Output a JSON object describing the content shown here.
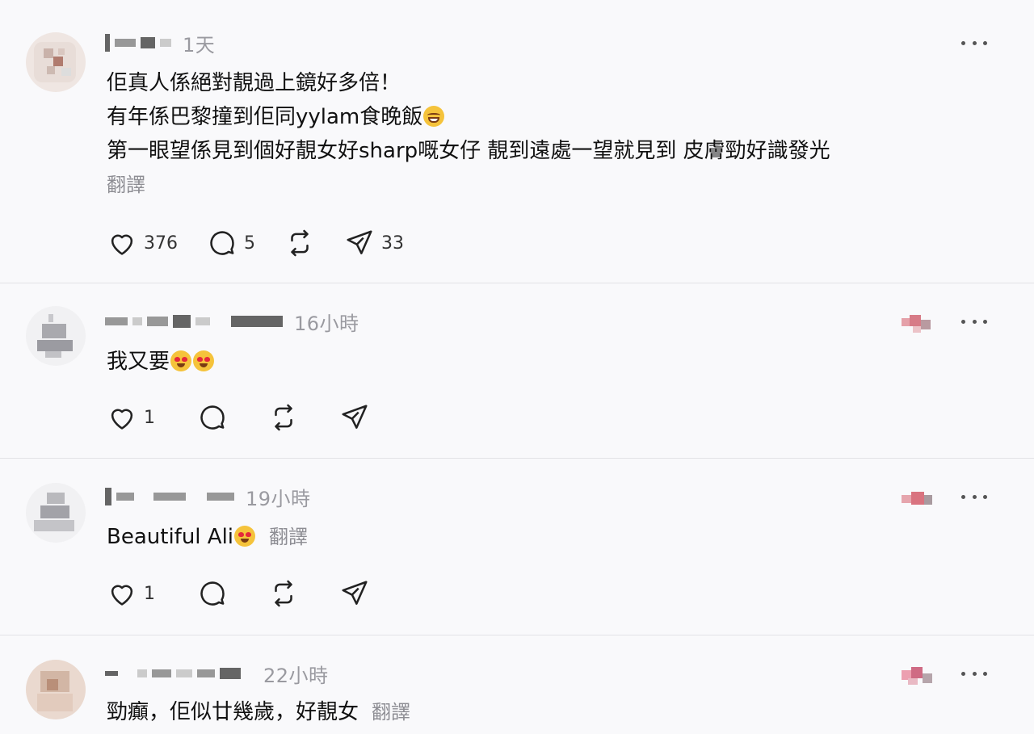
{
  "posts": [
    {
      "time": "1天",
      "lines": [
        "佢真人係絕對靚過上鏡好多倍！",
        "有年係巴黎撞到佢同yylam食晚飯",
        "第一眼望係見到個好靚女好sharp嘅女仔 靚到遠處一望就見到 皮膚勁好識發光"
      ],
      "translate_label": "翻譯",
      "counts": {
        "likes": "376",
        "comments": "5",
        "reposts": "",
        "shares": "33"
      }
    },
    {
      "time": "16小時",
      "text": "我又要",
      "counts": {
        "likes": "1"
      }
    },
    {
      "time": "19小時",
      "text": "Beautiful Ali",
      "translate_label": "翻譯",
      "counts": {
        "likes": "1"
      }
    },
    {
      "time": "22小時",
      "text": "勁癲，佢似廿幾歲，好靚女",
      "translate_label": "翻譯"
    }
  ],
  "icons": {
    "like": "heart-icon",
    "comment": "comment-bubble-icon",
    "repost": "repost-icon",
    "share": "send-icon",
    "more": "more-options-icon"
  },
  "colors": {
    "meta_gray": "#9a9aa0",
    "background": "#f9f9fb"
  }
}
